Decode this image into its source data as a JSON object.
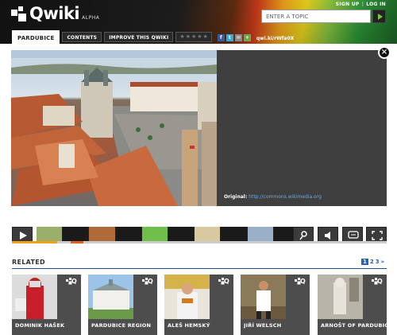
{
  "header": {
    "logo_text": "Qwiki",
    "logo_badge": "ALPHA",
    "top_links": {
      "sign_up": "SIGN UP",
      "separator": "|",
      "log_in": "LOG IN"
    },
    "search": {
      "placeholder": "ENTER A TOPIC"
    },
    "tabs": [
      {
        "label": "PARDUBICE",
        "active": true
      },
      {
        "label": "CONTENTS",
        "active": false
      },
      {
        "label": "IMPROVE THIS QWIKI",
        "active": false
      }
    ],
    "rating": {
      "stars": 0,
      "max": 5
    },
    "social_icons": [
      "facebook-icon",
      "twitter-icon",
      "email-icon",
      "share-icon"
    ],
    "short_url": "qwi.ki/rWfa0X"
  },
  "stage": {
    "caption_label": "Original:",
    "caption_url": "http://commons.wikimedia.org"
  },
  "timeline": {
    "play_icon": "play-icon",
    "right_icons": [
      "map-pin-icon",
      "speaker-icon",
      "comment-icon",
      "fullscreen-icon"
    ],
    "thumb_colors": [
      "#9ab06a",
      "#1a1a1a",
      "#b06a3a",
      "#1a1a1a",
      "#6fbf4a",
      "#1a1a1a",
      "#d9c9a0",
      "#1a1a1a",
      "#9ab0c8",
      "#1a1a1a"
    ],
    "progress": 0.12,
    "progress_color": "#f4a11a"
  },
  "related": {
    "label": "RELATED",
    "pages": [
      "1",
      "2",
      "3",
      "»"
    ],
    "current_page": "1",
    "cards": [
      {
        "label": "DOMINIK HAŠEK"
      },
      {
        "label": "PARDUBICE REGION"
      },
      {
        "label": "ALEŠ HEMSKÝ"
      },
      {
        "label": "JIŘÍ WELSCH"
      },
      {
        "label": "ARNOŠT OF PARDUBICE"
      }
    ]
  },
  "colors": {
    "accent_blue": "#2463b0",
    "accent_green": "#7cc242",
    "card_bg": "#4d4d4d"
  }
}
